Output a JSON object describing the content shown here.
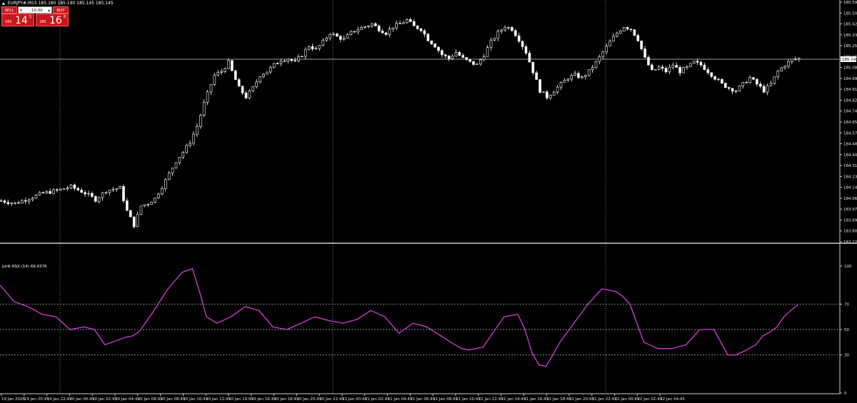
{
  "header": {
    "symbol_line": "EURJPY#,M15  185.180 185.190 185.145 185.145"
  },
  "trade_panel": {
    "sell_label": "SELL",
    "buy_label": "BUY",
    "lot_value": "10.00",
    "sell_prefix": "185",
    "sell_big": "14",
    "sell_sup": "5",
    "buy_prefix": "185",
    "buy_big": "16",
    "buy_sup": "8"
  },
  "colors": {
    "background": "#000000",
    "candle": "#ffffff",
    "rsx_line": "#d63bd6",
    "grid": "#8a8a8a",
    "panel_red": "#c9161c"
  },
  "chart_data": [
    {
      "type": "candlestick",
      "title": "",
      "ylim": [
        183.72,
        185.59
      ],
      "y_ticks": [
        "185.590",
        "185.505",
        "185.420",
        "185.335",
        "185.250",
        "185.165",
        "185.080",
        "184.995",
        "184.910",
        "184.825",
        "184.740",
        "184.655",
        "184.570",
        "184.485",
        "184.400",
        "184.315",
        "184.230",
        "184.145",
        "184.060",
        "183.975",
        "183.890",
        "183.805",
        "183.720"
      ],
      "current_price_label": "185.145",
      "current_price": 185.145,
      "x_tick_labels": [
        "19 Jan 2026",
        "19 Jan 20:45",
        "19 Jan 22:45",
        "20 Jan 00:45",
        "20 Jan 02:45",
        "20 Jan 04:45",
        "20 Jan 06:45",
        "20 Jan 08:45",
        "20 Jan 10:45",
        "20 Jan 12:45",
        "20 Jan 14:45",
        "20 Jan 16:45",
        "20 Jan 18:45",
        "20 Jan 20:45",
        "20 Jan 22:45",
        "21 Jan 00:45",
        "21 Jan 02:45",
        "21 Jan 04:45",
        "21 Jan 06:45",
        "21 Jan 08:45",
        "21 Jan 10:45",
        "21 Jan 12:45",
        "21 Jan 14:45",
        "21 Jan 16:45",
        "21 Jan 18:45",
        "21 Jan 20:45",
        "21 Jan 22:45",
        "22 Jan 00:45",
        "22 Jan 02:45",
        "22 Jan 04:45"
      ],
      "close_path": [
        [
          0,
          184.04
        ],
        [
          4,
          184.02
        ],
        [
          8,
          184.06
        ],
        [
          12,
          184.1
        ],
        [
          16,
          184.12
        ],
        [
          20,
          184.15
        ],
        [
          24,
          184.1
        ],
        [
          27,
          184.05
        ],
        [
          30,
          184.12
        ],
        [
          34,
          184.14
        ],
        [
          36,
          183.96
        ],
        [
          38,
          183.85
        ],
        [
          40,
          184.0
        ],
        [
          42,
          184.02
        ],
        [
          44,
          184.06
        ],
        [
          46,
          184.15
        ],
        [
          48,
          184.25
        ],
        [
          50,
          184.35
        ],
        [
          52,
          184.42
        ],
        [
          54,
          184.5
        ],
        [
          56,
          184.62
        ],
        [
          58,
          184.8
        ],
        [
          60,
          184.95
        ],
        [
          61,
          185.02
        ],
        [
          63,
          185.05
        ],
        [
          65,
          185.12
        ],
        [
          66,
          185.05
        ],
        [
          68,
          184.92
        ],
        [
          70,
          184.85
        ],
        [
          72,
          184.92
        ],
        [
          74,
          185.02
        ],
        [
          76,
          185.05
        ],
        [
          78,
          185.1
        ],
        [
          80,
          185.14
        ],
        [
          82,
          185.15
        ],
        [
          84,
          185.12
        ],
        [
          86,
          185.18
        ],
        [
          88,
          185.25
        ],
        [
          90,
          185.22
        ],
        [
          92,
          185.28
        ],
        [
          94,
          185.35
        ],
        [
          96,
          185.32
        ],
        [
          98,
          185.3
        ],
        [
          100,
          185.35
        ],
        [
          102,
          185.38
        ],
        [
          104,
          185.4
        ],
        [
          106,
          185.42
        ],
        [
          108,
          185.38
        ],
        [
          110,
          185.35
        ],
        [
          112,
          185.4
        ],
        [
          114,
          185.42
        ],
        [
          116,
          185.45
        ],
        [
          118,
          185.4
        ],
        [
          120,
          185.38
        ],
        [
          122,
          185.3
        ],
        [
          124,
          185.25
        ],
        [
          126,
          185.18
        ],
        [
          128,
          185.15
        ],
        [
          130,
          185.2
        ],
        [
          132,
          185.15
        ],
        [
          134,
          185.12
        ],
        [
          136,
          185.1
        ],
        [
          138,
          185.18
        ],
        [
          140,
          185.28
        ],
        [
          142,
          185.35
        ],
        [
          144,
          185.4
        ],
        [
          146,
          185.38
        ],
        [
          148,
          185.3
        ],
        [
          150,
          185.2
        ],
        [
          152,
          185.05
        ],
        [
          154,
          184.9
        ],
        [
          156,
          184.85
        ],
        [
          158,
          184.9
        ],
        [
          160,
          184.95
        ],
        [
          162,
          185.0
        ],
        [
          164,
          185.02
        ],
        [
          166,
          185.0
        ],
        [
          168,
          185.05
        ],
        [
          170,
          185.12
        ],
        [
          172,
          185.2
        ],
        [
          174,
          185.28
        ],
        [
          176,
          185.35
        ],
        [
          178,
          185.4
        ],
        [
          180,
          185.38
        ],
        [
          182,
          185.3
        ],
        [
          184,
          185.15
        ],
        [
          186,
          185.05
        ],
        [
          188,
          185.08
        ],
        [
          190,
          185.05
        ],
        [
          192,
          185.1
        ],
        [
          194,
          185.05
        ],
        [
          196,
          185.08
        ],
        [
          198,
          185.12
        ],
        [
          200,
          185.1
        ],
        [
          202,
          185.05
        ],
        [
          204,
          185.0
        ],
        [
          206,
          184.95
        ],
        [
          208,
          184.92
        ],
        [
          210,
          184.9
        ],
        [
          212,
          184.95
        ],
        [
          214,
          185.0
        ],
        [
          216,
          184.95
        ],
        [
          218,
          184.9
        ],
        [
          220,
          184.95
        ],
        [
          222,
          185.05
        ],
        [
          224,
          185.1
        ],
        [
          226,
          185.14
        ],
        [
          228,
          185.15
        ]
      ]
    },
    {
      "type": "line",
      "title": "",
      "series_label": "Jurik RSX (14) 69.4376",
      "ylim": [
        0,
        100
      ],
      "y_ticks": [
        "100",
        "70",
        "50",
        "30",
        "0"
      ],
      "levels": [
        70,
        50,
        30
      ],
      "x": [
        0,
        4,
        8,
        12,
        16,
        20,
        24,
        27,
        30,
        34,
        36,
        38,
        40,
        44,
        48,
        52,
        55,
        57,
        59,
        62,
        66,
        70,
        74,
        78,
        82,
        86,
        90,
        94,
        98,
        102,
        106,
        110,
        114,
        118,
        122,
        126,
        130,
        132,
        134,
        138,
        144,
        148,
        150,
        152,
        154,
        156,
        158,
        160,
        164,
        168,
        172,
        176,
        178,
        180,
        184,
        188,
        192,
        196,
        200,
        204,
        206,
        208,
        210,
        212,
        214,
        216,
        218,
        220,
        222,
        224,
        226,
        228
      ],
      "values": [
        85,
        72,
        68,
        62,
        60,
        50,
        52,
        50,
        38,
        42,
        44,
        45,
        49,
        65,
        82,
        95,
        98,
        80,
        60,
        55,
        60,
        68,
        65,
        52,
        50,
        55,
        60,
        57,
        55,
        58,
        65,
        60,
        47,
        55,
        52,
        45,
        38,
        35,
        34,
        36,
        60,
        62,
        50,
        32,
        22,
        21,
        30,
        40,
        55,
        70,
        82,
        80,
        76,
        70,
        40,
        35,
        35,
        38,
        50,
        50,
        40,
        30,
        30,
        32,
        35,
        38,
        45,
        48,
        52,
        60,
        65,
        69.4376
      ]
    }
  ]
}
